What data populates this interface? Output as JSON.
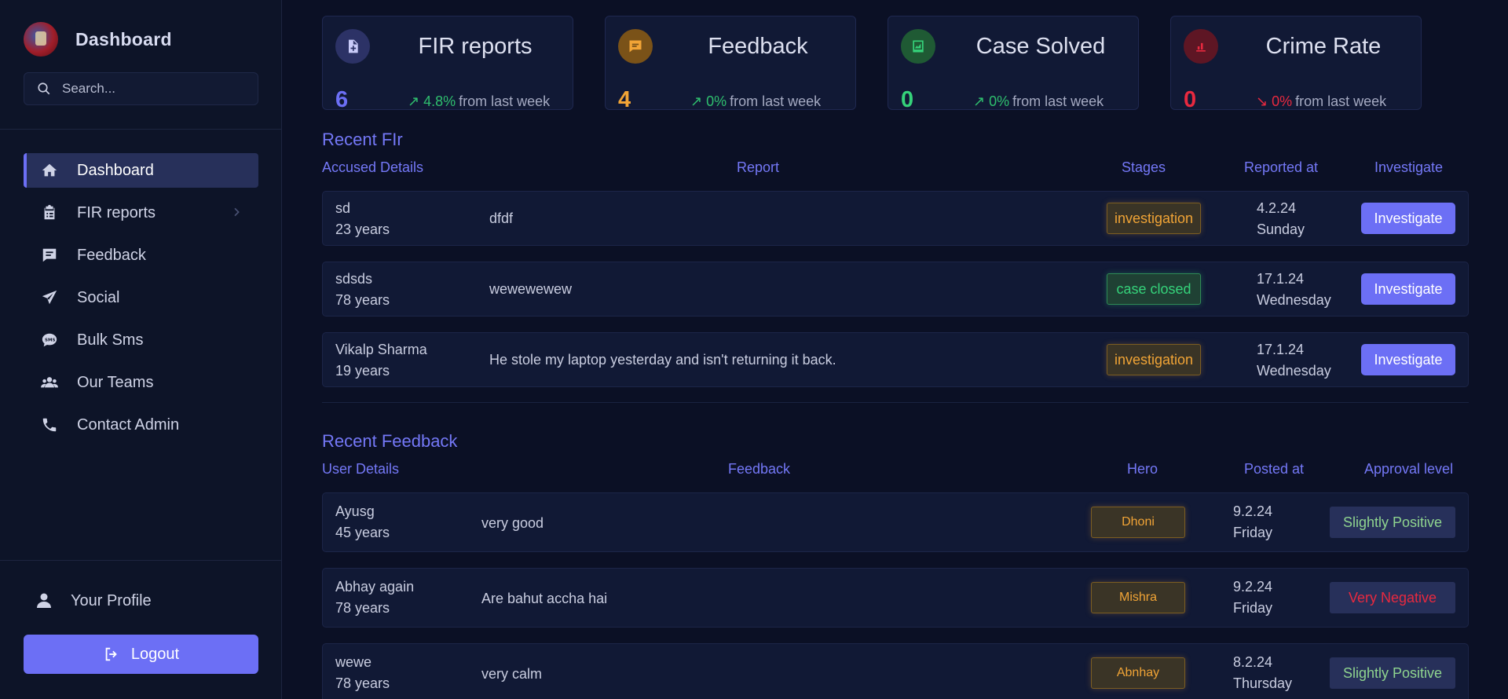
{
  "sidebar": {
    "brand_title": "Dashboard",
    "search_placeholder": "Search...",
    "nav": [
      {
        "label": "Dashboard",
        "icon": "home-icon"
      },
      {
        "label": "FIR reports",
        "icon": "clipboard-icon"
      },
      {
        "label": "Feedback",
        "icon": "message-icon"
      },
      {
        "label": "Social",
        "icon": "paper-plane-icon"
      },
      {
        "label": "Bulk Sms",
        "icon": "sms-icon"
      },
      {
        "label": "Our Teams",
        "icon": "users-icon"
      },
      {
        "label": "Contact Admin",
        "icon": "phone-icon"
      }
    ],
    "profile_label": "Your Profile",
    "logout_label": "Logout"
  },
  "cards": [
    {
      "title": "FIR reports",
      "value": "6",
      "pct": "↗ 4.8%",
      "suffix": "from last week",
      "color": "#6c6ff5",
      "trend_color": "#2fbf6e",
      "icon": "file-plus-icon"
    },
    {
      "title": "Feedback",
      "value": "4",
      "pct": "↗ 0%",
      "suffix": "from last week",
      "color": "#f1a436",
      "trend_color": "#2fbf6e",
      "icon": "chat-icon"
    },
    {
      "title": "Case Solved",
      "value": "0",
      "pct": "↗ 0%",
      "suffix": "from last week",
      "color": "#35d27a",
      "trend_color": "#2fbf6e",
      "icon": "chart-icon"
    },
    {
      "title": "Crime Rate",
      "value": "0",
      "pct": "↘ 0%",
      "suffix": "from last week",
      "color": "#e8293f",
      "trend_color": "#e8293f",
      "icon": "bar-chart-icon"
    }
  ],
  "fir": {
    "title": "Recent FIr",
    "headers": {
      "accused": "Accused Details",
      "report": "Report",
      "stages": "Stages",
      "reported": "Reported at",
      "investigate": "Investigate"
    },
    "rows": [
      {
        "name": "sd",
        "age": "23 years",
        "report": "dfdf",
        "stage": "investigation",
        "date": "4.2.24",
        "day": "Sunday",
        "button": "Investigate"
      },
      {
        "name": "sdsds",
        "age": "78 years",
        "report": "wewewewew",
        "stage": "case closed",
        "date": "17.1.24",
        "day": "Wednesday",
        "button": "Investigate"
      },
      {
        "name": "Vikalp Sharma",
        "age": "19 years",
        "report": "He stole my laptop yesterday and isn't returning it back.",
        "stage": "investigation",
        "date": "17.1.24",
        "day": "Wednesday",
        "button": "Investigate"
      }
    ]
  },
  "feedback": {
    "title": "Recent Feedback",
    "headers": {
      "user": "User Details",
      "feedback": "Feedback",
      "hero": "Hero",
      "posted": "Posted at",
      "approval": "Approval level"
    },
    "rows": [
      {
        "name": "Ayusg",
        "age": "45 years",
        "feedback": "very good",
        "hero": "Dhoni",
        "date": "9.2.24",
        "day": "Friday",
        "approval": "Slightly Positive",
        "approval_color": "#8fd48f"
      },
      {
        "name": "Abhay again",
        "age": "78 years",
        "feedback": "Are bahut accha hai",
        "hero": "Mishra",
        "date": "9.2.24",
        "day": "Friday",
        "approval": "Very Negative",
        "approval_color": "#e8293f"
      },
      {
        "name": "wewe",
        "age": "78 years",
        "feedback": "very calm",
        "hero": "Abnhay",
        "date": "8.2.24",
        "day": "Thursday",
        "approval": "Slightly Positive",
        "approval_color": "#8fd48f"
      }
    ]
  }
}
